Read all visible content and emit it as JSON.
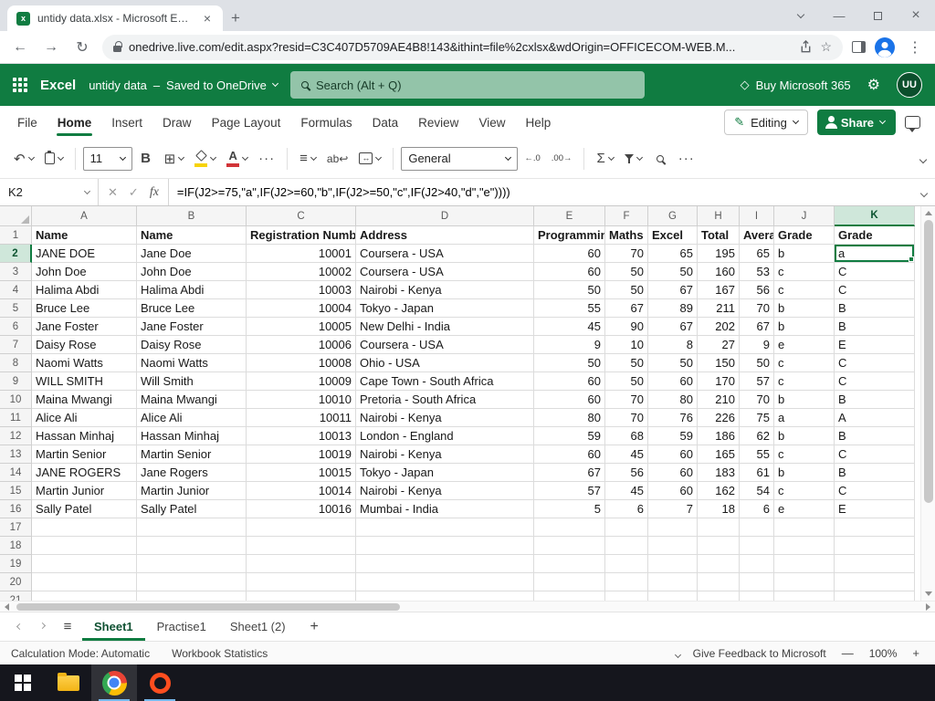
{
  "browser": {
    "tab_title": "untidy data.xlsx - Microsoft Excel",
    "url": "onedrive.live.com/edit.aspx?resid=C3C407D5709AE4B8!143&ithint=file%2cxlsx&wdOrigin=OFFICECOM-WEB.M..."
  },
  "header": {
    "app_name": "Excel",
    "doc_title": "untidy data",
    "doc_separator": "–",
    "doc_status": "Saved to OneDrive",
    "search_placeholder": "Search (Alt + Q)",
    "buy_label": "Buy Microsoft 365",
    "avatar_initials": "UU"
  },
  "menu": {
    "items": [
      "File",
      "Home",
      "Insert",
      "Draw",
      "Page Layout",
      "Formulas",
      "Data",
      "Review",
      "View",
      "Help"
    ],
    "active": "Home",
    "editing_label": "Editing",
    "share_label": "Share"
  },
  "toolbar": {
    "font_size": "11",
    "number_format": "General"
  },
  "formula_bar": {
    "name_box": "K2",
    "fx_label": "fx",
    "formula": "=IF(J2>=75,\"a\",IF(J2>=60,\"b\",IF(J2>=50,\"c\",IF(J2>40,\"d\",\"e\"))))"
  },
  "grid": {
    "columns": [
      "A",
      "B",
      "C",
      "D",
      "E",
      "F",
      "G",
      "H",
      "I",
      "J",
      "K"
    ],
    "selection": {
      "cell": "K2",
      "col": "K",
      "row": 2
    },
    "last_visible_row": 21,
    "rows": [
      {
        "n": 1,
        "cells": [
          "Name",
          "Name",
          "Registration Number",
          "Address",
          "Programming",
          "Maths",
          "Excel",
          "Total",
          "Average",
          "Grade",
          "Grade"
        ]
      },
      {
        "n": 2,
        "cells": [
          "JANE DOE",
          "Jane Doe",
          "10001",
          "Coursera - USA",
          "60",
          "70",
          "65",
          "195",
          "65",
          "b",
          "a"
        ]
      },
      {
        "n": 3,
        "cells": [
          "John Doe",
          "John Doe",
          "10002",
          "Coursera - USA",
          "60",
          "50",
          "50",
          "160",
          "53",
          "c",
          "C"
        ]
      },
      {
        "n": 4,
        "cells": [
          "Halima Abdi",
          "Halima Abdi",
          "10003",
          "Nairobi - Kenya",
          "50",
          "50",
          "67",
          "167",
          "56",
          "c",
          "C"
        ]
      },
      {
        "n": 5,
        "cells": [
          "Bruce Lee",
          "Bruce Lee",
          "10004",
          "Tokyo - Japan",
          "55",
          "67",
          "89",
          "211",
          "70",
          "b",
          "B"
        ]
      },
      {
        "n": 6,
        "cells": [
          "Jane Foster",
          "Jane Foster",
          "10005",
          "New Delhi - India",
          "45",
          "90",
          "67",
          "202",
          "67",
          "b",
          "B"
        ]
      },
      {
        "n": 7,
        "cells": [
          "Daisy Rose",
          "Daisy Rose",
          "10006",
          "Coursera - USA",
          "9",
          "10",
          "8",
          "27",
          "9",
          "e",
          "E"
        ]
      },
      {
        "n": 8,
        "cells": [
          "Naomi Watts",
          "Naomi Watts",
          "10008",
          "Ohio - USA",
          "50",
          "50",
          "50",
          "150",
          "50",
          "c",
          "C"
        ]
      },
      {
        "n": 9,
        "cells": [
          "WILL SMITH",
          "Will Smith",
          "10009",
          "Cape Town - South Africa",
          "60",
          "50",
          "60",
          "170",
          "57",
          "c",
          "C"
        ]
      },
      {
        "n": 10,
        "cells": [
          "Maina Mwangi",
          "Maina Mwangi",
          "10010",
          "Pretoria - South Africa",
          "60",
          "70",
          "80",
          "210",
          "70",
          "b",
          "B"
        ]
      },
      {
        "n": 11,
        "cells": [
          "Alice Ali",
          "Alice Ali",
          "10011",
          "Nairobi - Kenya",
          "80",
          "70",
          "76",
          "226",
          "75",
          "a",
          "A"
        ]
      },
      {
        "n": 12,
        "cells": [
          "Hassan Minhaj",
          "Hassan Minhaj",
          "10013",
          "London - England",
          "59",
          "68",
          "59",
          "186",
          "62",
          "b",
          "B"
        ]
      },
      {
        "n": 13,
        "cells": [
          "Martin Senior",
          "Martin Senior",
          "10019",
          "Nairobi - Kenya",
          "60",
          "45",
          "60",
          "165",
          "55",
          "c",
          "C"
        ]
      },
      {
        "n": 14,
        "cells": [
          "JANE ROGERS",
          "Jane Rogers",
          "10015",
          "Tokyo - Japan",
          "67",
          "56",
          "60",
          "183",
          "61",
          "b",
          "B"
        ]
      },
      {
        "n": 15,
        "cells": [
          "Martin Junior",
          "Martin Junior",
          "10014",
          "Nairobi - Kenya",
          "57",
          "45",
          "60",
          "162",
          "54",
          "c",
          "C"
        ]
      },
      {
        "n": 16,
        "cells": [
          "Sally Patel",
          "Sally Patel",
          "10016",
          "Mumbai - India",
          "5",
          "6",
          "7",
          "18",
          "6",
          "e",
          "E"
        ]
      }
    ]
  },
  "sheet_tabs": {
    "tabs": [
      "Sheet1",
      "Practise1",
      "Sheet1 (2)"
    ],
    "active": "Sheet1",
    "add_label": "+"
  },
  "status_bar": {
    "calc_mode": "Calculation Mode: Automatic",
    "workbook_stats": "Workbook Statistics",
    "feedback": "Give Feedback to Microsoft",
    "zoom": "100%",
    "zoom_out": "—",
    "zoom_in": "+"
  },
  "icons": {
    "excel_favicon_letter": "x",
    "close": "×",
    "minimize": "—",
    "new_tab": "+",
    "back": "←",
    "forward": "→",
    "reload": "↻",
    "star": "☆",
    "menu_dots": "⋮",
    "diamond": "◇",
    "gear": "⚙",
    "undo": "↶",
    "bold": "B",
    "borders": "⊞",
    "font_color_letter": "A",
    "more": "···",
    "align": "≡",
    "wrap": "ab↩",
    "merge": "↔",
    "inc_decimal": "←.0",
    "dec_decimal": ".00→",
    "sigma": "Σ",
    "cancel": "✕",
    "enter": "✓"
  },
  "colors": {
    "excel_green": "#107c41",
    "fill_yellow": "#f7d308",
    "font_red": "#d13438"
  }
}
